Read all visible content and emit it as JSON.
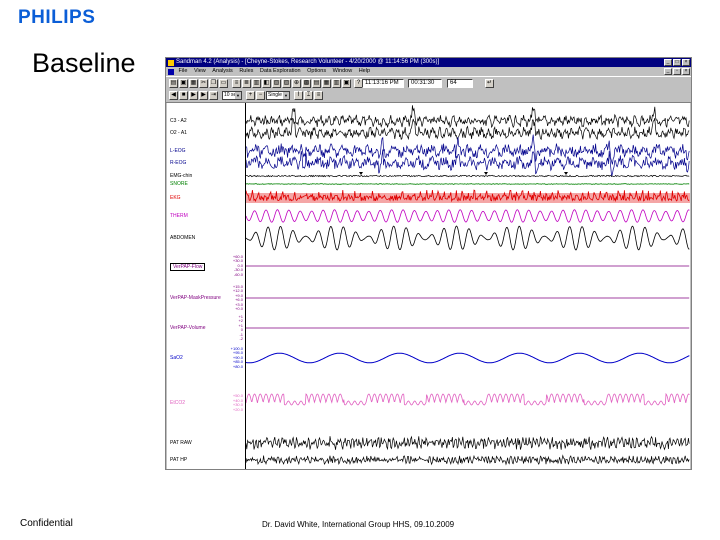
{
  "brand": {
    "logo_text": "PHILIPS",
    "color": "#0b5ed7"
  },
  "slide": {
    "title": "Baseline",
    "footer_left": "Confidential",
    "footer_center": "Dr. David White, International Group HHS, 09.10.2009"
  },
  "app": {
    "window_title": "Sandman 4.2 (Analysis) - [Cheyne-Stokes, Research Volunteer - 4/20/2000 @ 11:14:56 PM (300s)]",
    "menu": [
      "File",
      "View",
      "Analysis",
      "Rules",
      "Data Exploration",
      "Options",
      "Window",
      "Help"
    ],
    "toolbar": {
      "clock_time": "11:13:16 PM",
      "elapsed": "00:31:30",
      "epoch": "64",
      "window_size": "10 sec",
      "view_mode": "Single"
    }
  },
  "channels": [
    {
      "label": "C3 - A2",
      "color": "#000000",
      "scale": []
    },
    {
      "label": "O2 - A1",
      "color": "#000000",
      "scale": []
    },
    {
      "label": "L-EOG",
      "color": "#00008b",
      "scale": []
    },
    {
      "label": "R-EOG",
      "color": "#00008b",
      "scale": []
    },
    {
      "label": "EMG-chin",
      "color": "#000000",
      "scale": []
    },
    {
      "label": "SNORE",
      "color": "#008000",
      "scale": []
    },
    {
      "label": "EKG",
      "color": "#e00000",
      "scale": []
    },
    {
      "label": "THERM",
      "color": "#c000c0",
      "scale": []
    },
    {
      "label": "ABDOMEN",
      "color": "#000000",
      "scale": []
    },
    {
      "label": "VerPAP-Flow",
      "color": "#800080",
      "scale": [
        "+60.0",
        "+30.0",
        "0.0",
        "-30.0",
        "-60.0"
      ]
    },
    {
      "label": "VerPAP-MaskPressure",
      "color": "#800080",
      "scale": [
        "+15.0",
        "+12.0",
        "+9.0",
        "+6.0",
        "+3.0",
        "+0.0"
      ]
    },
    {
      "label": "VerPAP-Volume",
      "color": "#800080",
      "scale": [
        "+1",
        "+2",
        "+1",
        "0",
        "-1",
        "-2"
      ]
    },
    {
      "label": "SaO2",
      "color": "#0000c8",
      "scale": [
        "+100.0",
        "+95.0",
        "+90.0",
        "+85.0",
        "+80.0"
      ]
    },
    {
      "label": "EtCO2",
      "color": "#e060c0",
      "scale": [
        "+50.0",
        "+40.0",
        "+30.0",
        "+20.0"
      ]
    },
    {
      "label": "PAT RAW",
      "color": "#000000",
      "scale": []
    },
    {
      "label": "PAT HP",
      "color": "#000000",
      "scale": []
    }
  ]
}
